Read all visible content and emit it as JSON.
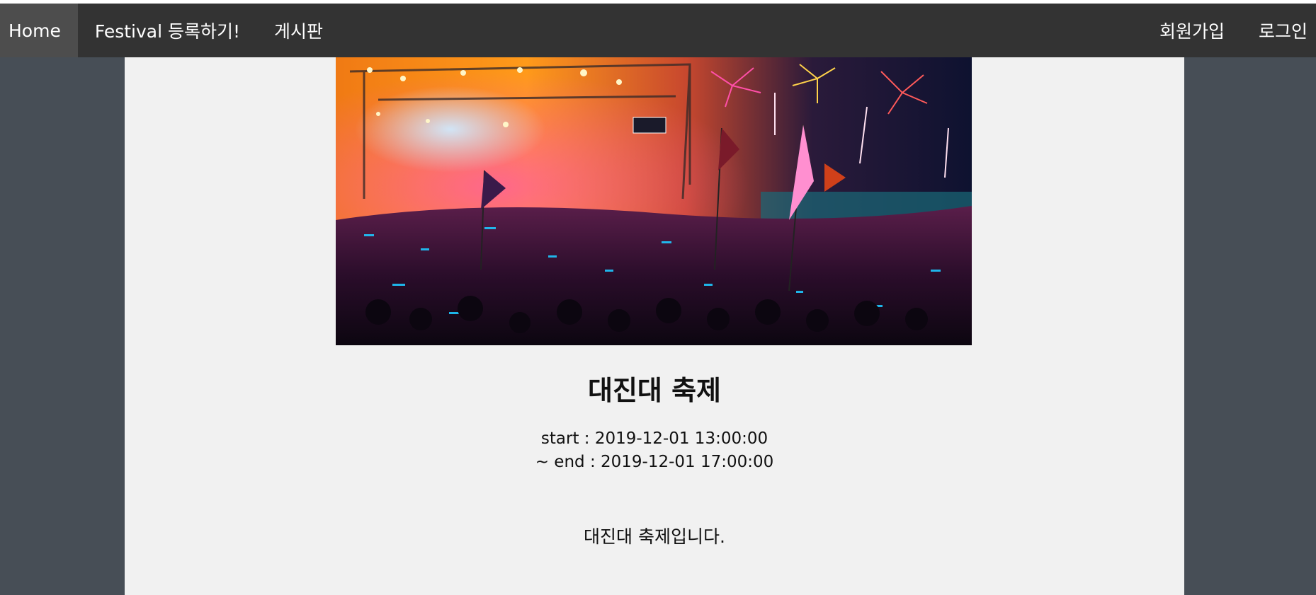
{
  "nav": {
    "home": "Home",
    "festival_register": "Festival 등록하기!",
    "board": "게시판",
    "signup": "회원가입",
    "login": "로그인"
  },
  "festival": {
    "title": "대진대 축제",
    "start_line": "start : 2019-12-01 13:00:00",
    "end_line": "~ end : 2019-12-01 17:00:00",
    "description": "대진대 축제입니다."
  },
  "colors": {
    "navbar_bg": "#333333",
    "nav_active_bg": "#4d4d4d",
    "page_bg": "#474e56",
    "content_bg": "#f1f1f1"
  }
}
